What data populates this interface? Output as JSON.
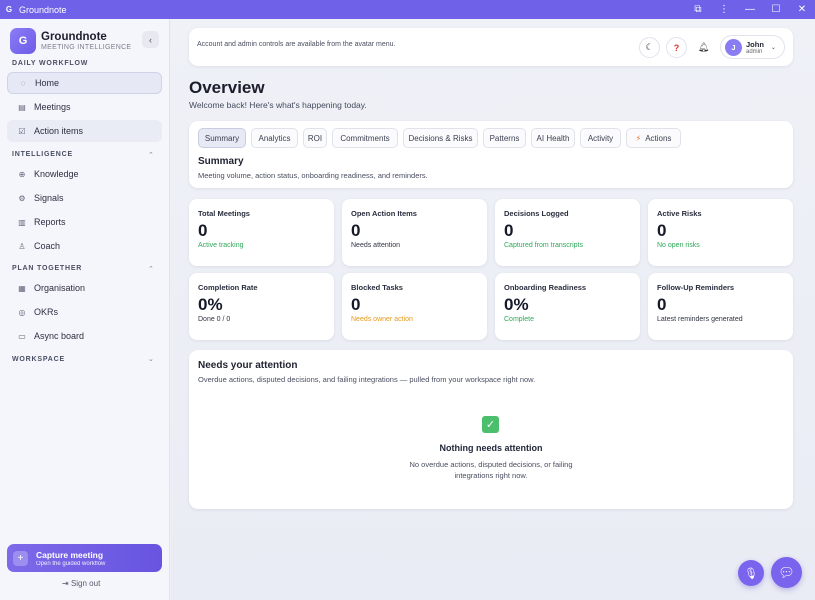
{
  "window": {
    "title": "Groundnote",
    "app_icon": "G"
  },
  "brand": {
    "logo_letter": "G",
    "name": "Groundnote",
    "tagline": "MEETING INTELLIGENCE"
  },
  "sidebar": {
    "sections": [
      {
        "title": "DAILY WORKFLOW",
        "items": [
          {
            "label": "Home",
            "icon": "home-icon"
          },
          {
            "label": "Meetings",
            "icon": "document-icon"
          },
          {
            "label": "Action items",
            "icon": "checkbox-icon"
          }
        ]
      },
      {
        "title": "INTELLIGENCE",
        "items": [
          {
            "label": "Knowledge",
            "icon": "globe-icon"
          },
          {
            "label": "Signals",
            "icon": "signal-icon"
          },
          {
            "label": "Reports",
            "icon": "bar-chart-icon"
          },
          {
            "label": "Coach",
            "icon": "coach-icon"
          }
        ]
      },
      {
        "title": "PLAN TOGETHER",
        "items": [
          {
            "label": "Organisation",
            "icon": "grid-icon"
          },
          {
            "label": "OKRs",
            "icon": "target-icon"
          },
          {
            "label": "Async board",
            "icon": "chat-icon"
          }
        ]
      },
      {
        "title": "WORKSPACE",
        "items": []
      }
    ],
    "capture": {
      "title": "Capture meeting",
      "subtitle": "Open the guided workflow"
    },
    "signout": "Sign out"
  },
  "topbar": {
    "notice": "Account and admin controls are available from the avatar menu.",
    "user": {
      "initial": "J",
      "name": "John",
      "role": "admin"
    }
  },
  "page": {
    "title": "Overview",
    "subtitle": "Welcome back! Here's what's happening today."
  },
  "tabs": [
    "Summary",
    "Analytics",
    "ROI",
    "Commitments",
    "Decisions & Risks",
    "Patterns",
    "AI Health",
    "Activity",
    "Actions"
  ],
  "summary": {
    "title": "Summary",
    "subtitle": "Meeting volume, action status, onboarding readiness, and reminders."
  },
  "stats": [
    {
      "label": "Total Meetings",
      "value": "0",
      "note": "Active tracking",
      "tone": "green"
    },
    {
      "label": "Open Action Items",
      "value": "0",
      "note": "Needs attention",
      "tone": "plain"
    },
    {
      "label": "Decisions Logged",
      "value": "0",
      "note": "Captured from transcripts",
      "tone": "green"
    },
    {
      "label": "Active Risks",
      "value": "0",
      "note": "No open risks",
      "tone": "green"
    },
    {
      "label": "Completion Rate",
      "value": "0%",
      "note": "Done 0 / 0",
      "tone": "plain"
    },
    {
      "label": "Blocked Tasks",
      "value": "0",
      "note": "Needs owner action",
      "tone": "orange"
    },
    {
      "label": "Onboarding Readiness",
      "value": "0%",
      "note": "Complete",
      "tone": "green"
    },
    {
      "label": "Follow-Up Reminders",
      "value": "0",
      "note": "Latest reminders generated",
      "tone": "plain"
    }
  ],
  "attention": {
    "title": "Needs your attention",
    "subtitle": "Overdue actions, disputed decisions, and failing integrations — pulled from your workspace right now.",
    "empty_title": "Nothing needs attention",
    "empty_sub": "No overdue actions, disputed decisions, or failing integrations right now."
  },
  "colors": {
    "accent": "#6f61e8",
    "success": "#2fa85a",
    "warning": "#e59a1d",
    "danger": "#e0332e"
  }
}
